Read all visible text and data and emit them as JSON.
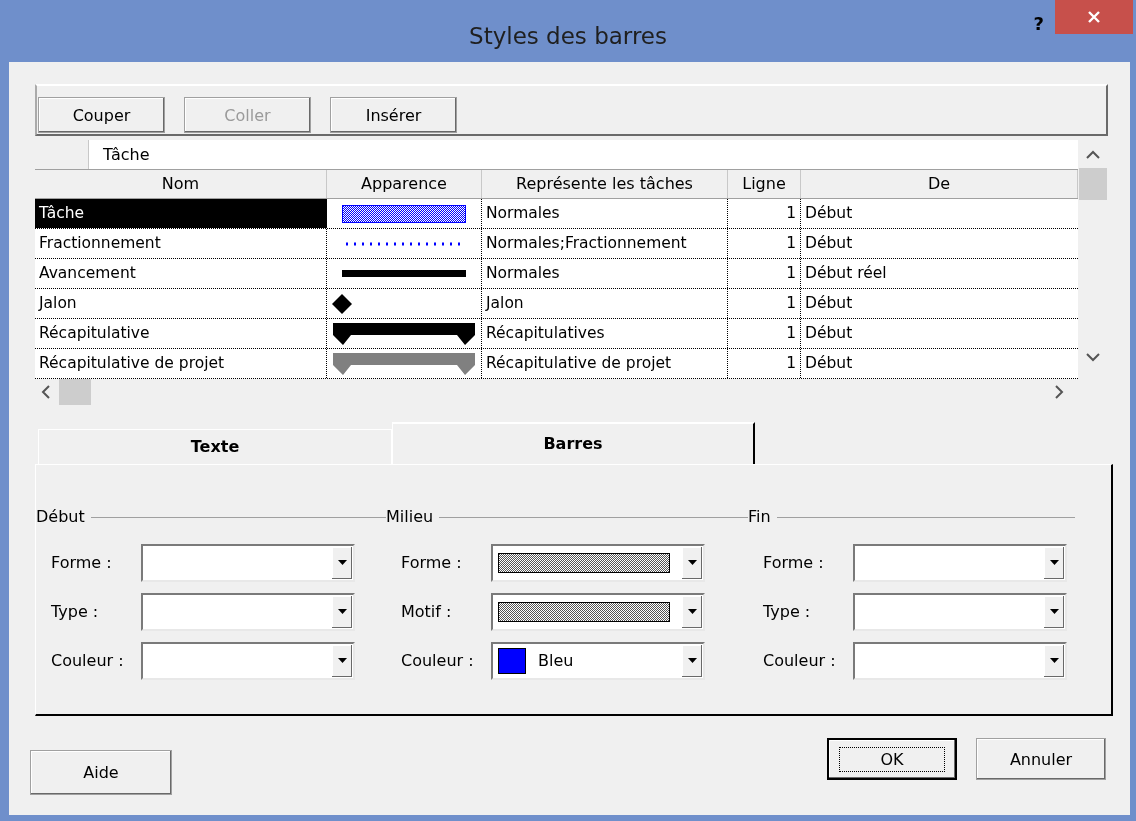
{
  "window": {
    "title": "Styles des barres",
    "help": "?"
  },
  "toolbar": {
    "buttons": [
      {
        "label": "Couper",
        "disabled": false
      },
      {
        "label": "Coller",
        "disabled": true
      },
      {
        "label": "Insérer",
        "disabled": false
      }
    ]
  },
  "table": {
    "entry_value": "Tâche",
    "columns": [
      "Nom",
      "Apparence",
      "Représente les tâches",
      "Ligne",
      "De"
    ],
    "rows": [
      {
        "name": "Tâche",
        "appearance": {
          "kind": "pattern-bar",
          "color": "#0000ff"
        },
        "represents": "Normales",
        "line": "1",
        "from": "Début",
        "selected": true
      },
      {
        "name": "Fractionnement",
        "appearance": {
          "kind": "dotted",
          "color": "#0000ff"
        },
        "represents": "Normales;Fractionnement",
        "line": "1",
        "from": "Début",
        "selected": false
      },
      {
        "name": "Avancement",
        "appearance": {
          "kind": "solid",
          "color": "#000000"
        },
        "represents": "Normales",
        "line": "1",
        "from": "Début réel",
        "selected": false
      },
      {
        "name": "Jalon",
        "appearance": {
          "kind": "diamond",
          "color": "#000000"
        },
        "represents": "Jalon",
        "line": "1",
        "from": "Début",
        "selected": false
      },
      {
        "name": "Récapitulative",
        "appearance": {
          "kind": "summary",
          "color": "#000000"
        },
        "represents": "Récapitulatives",
        "line": "1",
        "from": "Début",
        "selected": false
      },
      {
        "name": "Récapitulative de projet",
        "appearance": {
          "kind": "summary",
          "color": "#808080"
        },
        "represents": "Récapitulative de projet",
        "line": "1",
        "from": "Début",
        "selected": false
      }
    ]
  },
  "tabs": [
    {
      "label": "Texte",
      "selected": false
    },
    {
      "label": "Barres",
      "selected": true
    }
  ],
  "groups": [
    {
      "title": "Début",
      "fields": [
        {
          "label": "Forme :",
          "kind": "empty"
        },
        {
          "label": "Type :",
          "kind": "empty"
        },
        {
          "label": "Couleur :",
          "kind": "empty"
        }
      ]
    },
    {
      "title": "Milieu",
      "fields": [
        {
          "label": "Forme :",
          "kind": "pattern"
        },
        {
          "label": "Motif :",
          "kind": "pattern"
        },
        {
          "label": "Couleur :",
          "kind": "color",
          "color": "#0000ff",
          "value": "Bleu"
        }
      ]
    },
    {
      "title": "Fin",
      "fields": [
        {
          "label": "Forme :",
          "kind": "empty"
        },
        {
          "label": "Type :",
          "kind": "empty"
        },
        {
          "label": "Couleur :",
          "kind": "empty"
        }
      ]
    }
  ],
  "buttons": {
    "help": "Aide",
    "ok": {
      "label": "OK",
      "default": true
    },
    "cancel": "Annuler"
  }
}
